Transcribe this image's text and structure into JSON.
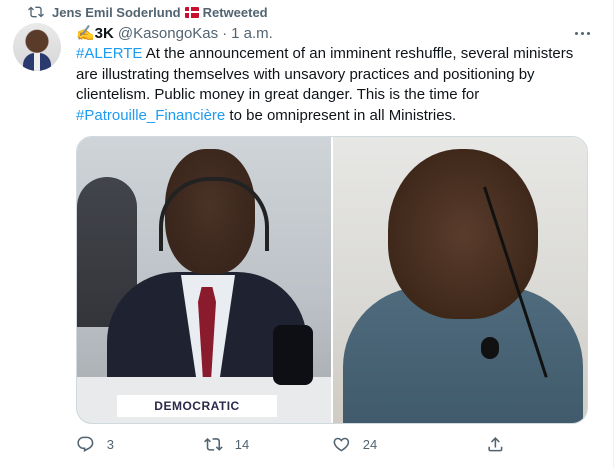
{
  "retweet_bar": {
    "retweeter": "Jens Emil Soderlund",
    "label": "Retweeted"
  },
  "tweet": {
    "display_name": "✍️3K",
    "handle": "@KasongoKas",
    "separator": "·",
    "time": "1 a.m.",
    "text": {
      "hashtag1": "#ALERTE",
      "part1": " At the announcement of an imminent reshuffle, several ministers are illustrating themselves with unsavory practices and positioning by clientelism. Public money in great danger. This is the time for ",
      "hashtag2": "#Patrouille_Financière",
      "part2": " to be omnipresent in all Ministries."
    },
    "media": {
      "plate_text": "DEMOCRATIC"
    },
    "actions": {
      "replies": "3",
      "retweets": "14",
      "likes": "24"
    }
  },
  "colors": {
    "accent": "#1d9bf0",
    "muted": "#536471",
    "text": "#0f1419"
  },
  "icons": [
    "retweet-icon",
    "denmark-flag-icon",
    "more-icon",
    "reply-icon",
    "like-icon",
    "share-icon"
  ]
}
